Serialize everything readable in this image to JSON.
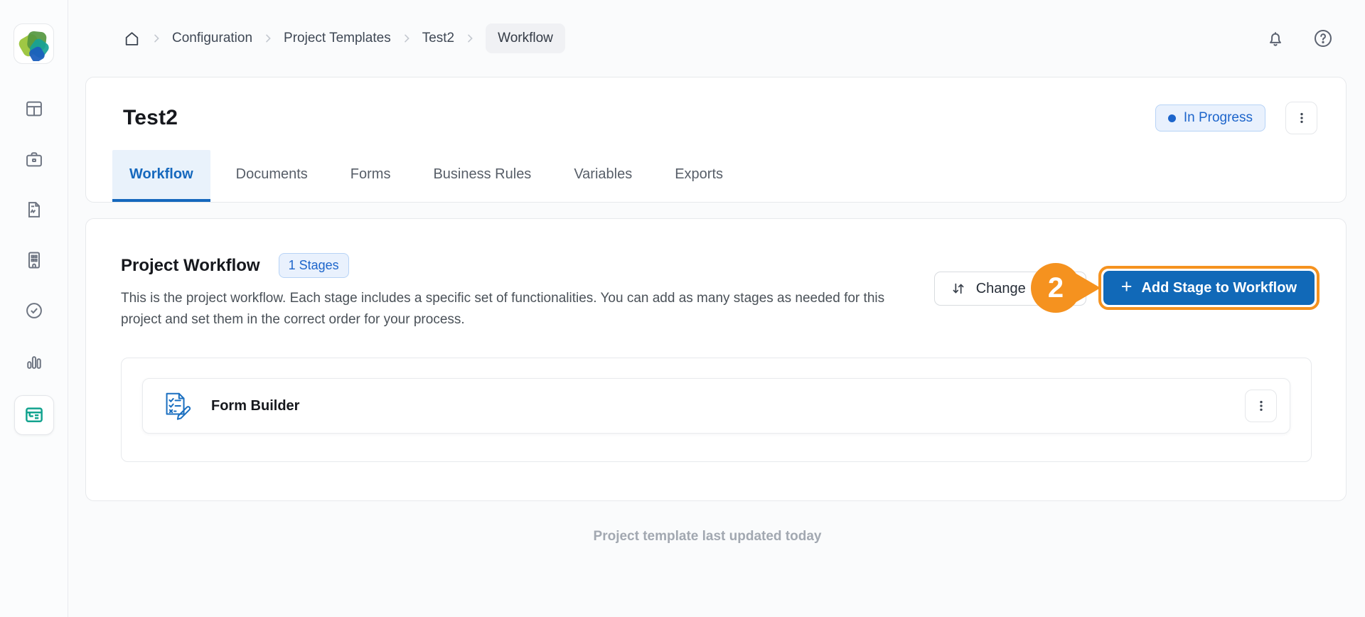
{
  "sidebar": {
    "items": [
      {
        "icon": "layout-icon",
        "active": false
      },
      {
        "icon": "briefcase-icon",
        "active": false
      },
      {
        "icon": "document-report-icon",
        "active": false
      },
      {
        "icon": "building-icon",
        "active": false
      },
      {
        "icon": "check-circle-icon",
        "active": false
      },
      {
        "icon": "bar-chart-icon",
        "active": false
      },
      {
        "icon": "form-template-icon",
        "active": true
      }
    ]
  },
  "breadcrumb": {
    "items": [
      {
        "label": "Configuration"
      },
      {
        "label": "Project Templates"
      },
      {
        "label": "Test2"
      },
      {
        "label": "Workflow"
      }
    ]
  },
  "topbar": {
    "icons": [
      "bell-icon",
      "help-icon"
    ]
  },
  "header": {
    "title": "Test2",
    "status_badge": "In Progress"
  },
  "tabs": [
    {
      "label": "Workflow",
      "active": true
    },
    {
      "label": "Documents",
      "active": false
    },
    {
      "label": "Forms",
      "active": false
    },
    {
      "label": "Business Rules",
      "active": false
    },
    {
      "label": "Variables",
      "active": false
    },
    {
      "label": "Exports",
      "active": false
    }
  ],
  "workflow_section": {
    "title": "Project Workflow",
    "stages_badge": "1 Stages",
    "description": "This is the project workflow. Each stage includes a specific set of functionalities. You can add as many stages as needed for this project and set them in the correct order for your process.",
    "change_button_label": "Change",
    "add_stage_button_label": "Add Stage to Workflow",
    "annotation_number": "2",
    "stages": [
      {
        "name": "Form Builder",
        "icon": "form-builder-icon"
      }
    ],
    "footer_note": "Project template last updated today"
  },
  "colors": {
    "primary_blue": "#1169b8",
    "accent_orange": "#f5921f",
    "active_teal": "#13a38f",
    "badge_blue_bg": "#e9f1fd",
    "badge_blue_text": "#1d65cb"
  }
}
